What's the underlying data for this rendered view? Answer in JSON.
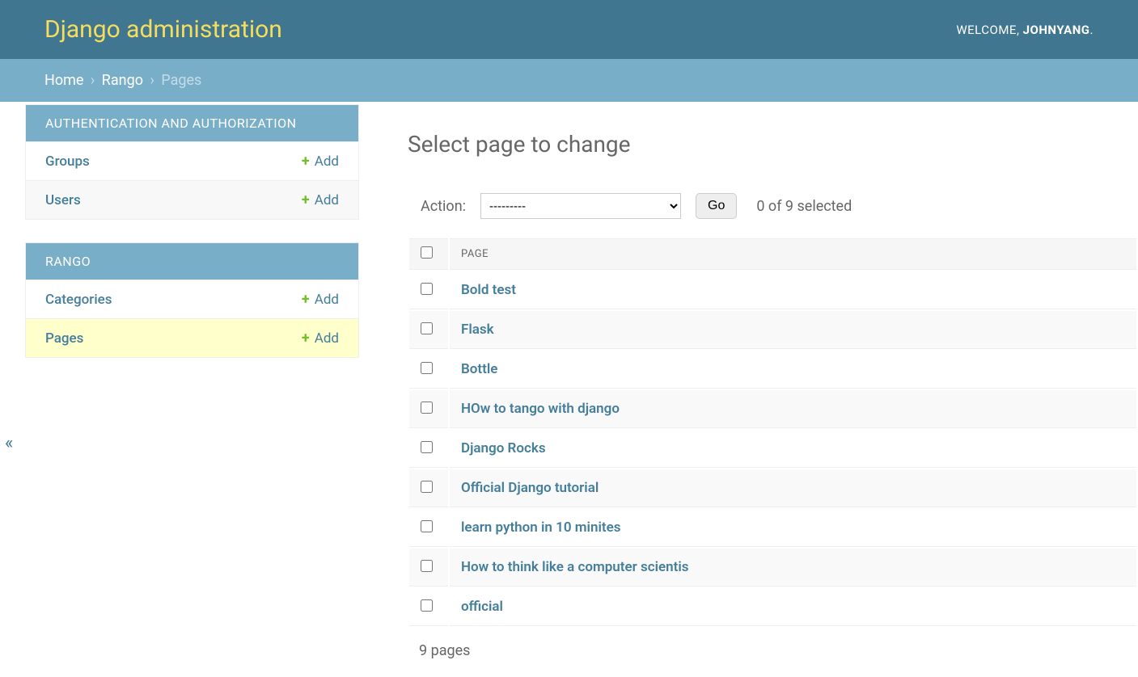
{
  "header": {
    "site_title": "Django administration",
    "welcome_text": "WELCOME, ",
    "username": "JOHNYANG",
    "suffix": ". "
  },
  "breadcrumbs": {
    "home": "Home",
    "app": "Rango",
    "current": "Pages"
  },
  "sidebar": {
    "collapse_symbol": "«",
    "sections": [
      {
        "title": "AUTHENTICATION AND AUTHORIZATION",
        "models": [
          {
            "name": "Groups",
            "add_label": "Add",
            "active": false
          },
          {
            "name": "Users",
            "add_label": "Add",
            "active": false
          }
        ]
      },
      {
        "title": "RANGO",
        "models": [
          {
            "name": "Categories",
            "add_label": "Add",
            "active": false
          },
          {
            "name": "Pages",
            "add_label": "Add",
            "active": true
          }
        ]
      }
    ]
  },
  "main": {
    "title": "Select page to change",
    "action_label": "Action:",
    "action_placeholder": "---------",
    "go_label": "Go",
    "selection_count": "0 of 9 selected",
    "column_header": "PAGE",
    "rows": [
      {
        "label": "Bold test"
      },
      {
        "label": "Flask"
      },
      {
        "label": "Bottle"
      },
      {
        "label": "HOw to tango with django"
      },
      {
        "label": "Django Rocks"
      },
      {
        "label": "Official Django tutorial"
      },
      {
        "label": "learn python in 10 minites"
      },
      {
        "label": "How to think like a computer scientis"
      },
      {
        "label": "official"
      }
    ],
    "paginator": "9 pages"
  }
}
